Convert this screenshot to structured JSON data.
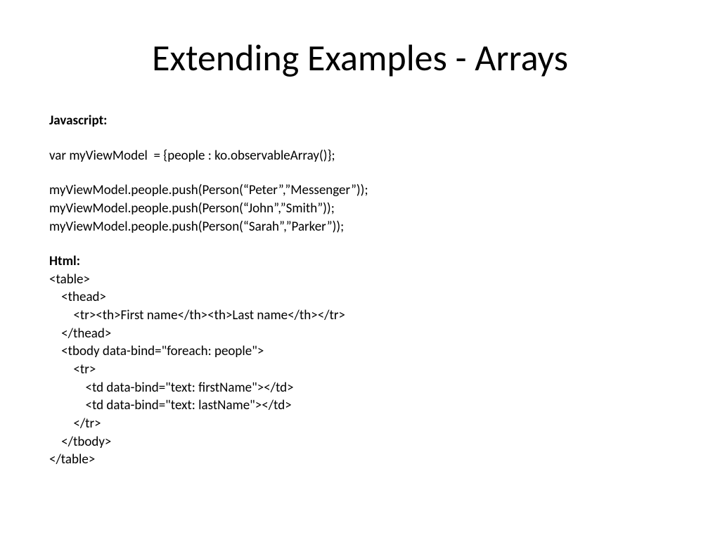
{
  "slide": {
    "title": "Extending Examples - Arrays",
    "js_label": "Javascript:",
    "js_line1": "var myViewModel  = {people : ko.observableArray()};",
    "js_line2": "myViewModel.people.push(Person(“Peter”,”Messenger”));",
    "js_line3": "myViewModel.people.push(Person(“John”,”Smith”));",
    "js_line4": "myViewModel.people.push(Person(“Sarah”,”Parker”));",
    "html_label": "Html:",
    "html_code": "<table>\n    <thead>\n        <tr><th>First name</th><th>Last name</th></tr>\n    </thead>\n    <tbody data-bind=\"foreach: people\">\n        <tr>\n            <td data-bind=\"text: firstName\"></td>\n            <td data-bind=\"text: lastName\"></td>\n        </tr>\n    </tbody>\n</table>"
  }
}
